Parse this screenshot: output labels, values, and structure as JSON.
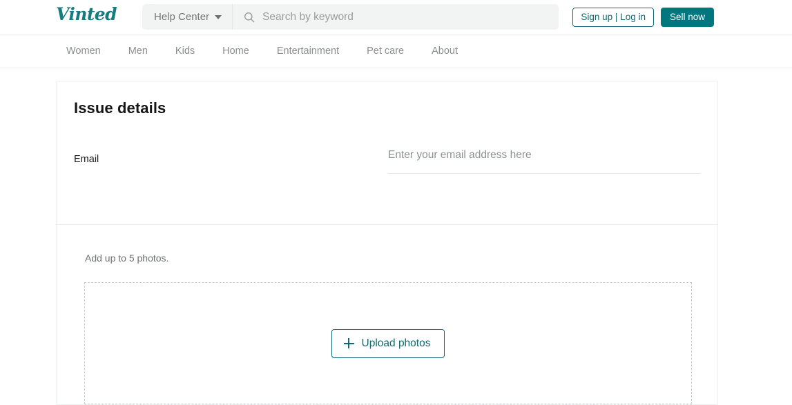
{
  "header": {
    "logo_text": "Vinted",
    "help_center_label": "Help Center",
    "help_center_icon": "chevron-down-icon",
    "search": {
      "icon": "search-icon",
      "placeholder": "Search by keyword",
      "value": ""
    },
    "auth_button_label": "Sign up | Log in",
    "sell_button_label": "Sell now"
  },
  "nav": {
    "items": [
      {
        "label": "Women"
      },
      {
        "label": "Men"
      },
      {
        "label": "Kids"
      },
      {
        "label": "Home"
      },
      {
        "label": "Entertainment"
      },
      {
        "label": "Pet care"
      },
      {
        "label": "About"
      }
    ]
  },
  "main": {
    "card_title": "Issue details",
    "email_field": {
      "label": "Email",
      "placeholder": "Enter your email address here",
      "value": ""
    },
    "photos": {
      "hint": "Add up to 5 photos.",
      "upload_button_label": "Upload photos",
      "upload_button_icon": "plus-icon"
    }
  },
  "colors": {
    "brand_teal": "#187b7f",
    "accent_teal": "#00767e",
    "link_teal": "#0e6a70",
    "border_grey": "#eceeef",
    "text_muted": "#8b8d8f"
  }
}
